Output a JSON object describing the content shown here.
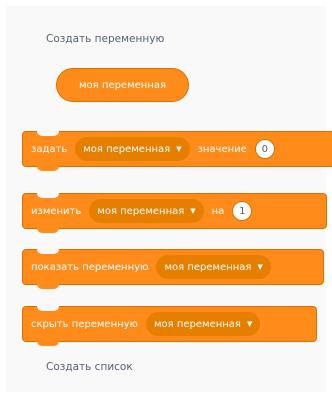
{
  "palette": {
    "make_variable_label": "Создать переменную",
    "make_list_label": "Создать список",
    "variable_reporter": "моя переменная",
    "blocks": {
      "set": {
        "keyword": "задать",
        "variable": "моя переменная",
        "connector": "значение",
        "value": "0"
      },
      "change": {
        "keyword": "изменить",
        "variable": "моя переменная",
        "connector": "на",
        "value": "1"
      },
      "show": {
        "keyword": "показать переменную",
        "variable": "моя переменная"
      },
      "hide": {
        "keyword": "скрыть переменную",
        "variable": "моя переменная"
      }
    },
    "colors": {
      "block_fill": "#ff8c1a",
      "block_border": "#db6e00",
      "dropdown_fill": "#e67e00",
      "label_text": "#575e75"
    }
  }
}
